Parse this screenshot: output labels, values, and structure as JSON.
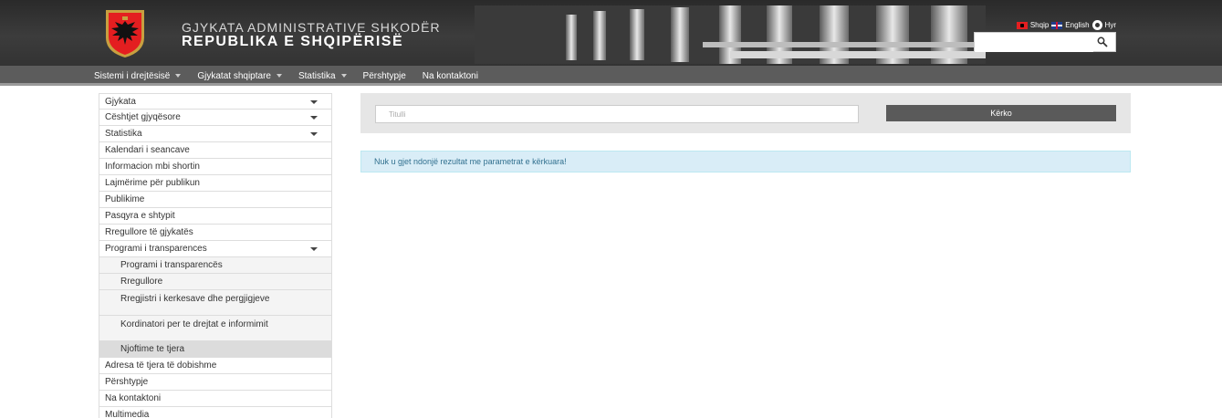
{
  "header": {
    "title": "GJYKATA ADMINISTRATIVE SHKODËR",
    "subtitle": "REPUBLIKA E SHQIPËRISË",
    "languages": [
      {
        "label": "Shqip",
        "icon": "albania-flag-icon"
      },
      {
        "label": "English",
        "icon": "uk-flag-icon"
      }
    ],
    "login_label": "Hyr",
    "search_placeholder": ""
  },
  "nav": {
    "items": [
      {
        "label": "Sistemi i drejtësisë",
        "dropdown": true
      },
      {
        "label": "Gjykatat shqiptare",
        "dropdown": true
      },
      {
        "label": "Statistika",
        "dropdown": true
      },
      {
        "label": "Përshtypje",
        "dropdown": false
      },
      {
        "label": "Na kontaktoni",
        "dropdown": false
      }
    ]
  },
  "sidebar": {
    "items": [
      {
        "label": "Gjykata",
        "dropdown": true
      },
      {
        "label": "Cështjet gjyqësore",
        "dropdown": true
      },
      {
        "label": "Statistika",
        "dropdown": true
      },
      {
        "label": "Kalendari i seancave"
      },
      {
        "label": "Informacion mbi shortin"
      },
      {
        "label": "Lajmërime për publikun"
      },
      {
        "label": "Publikime"
      },
      {
        "label": "Pasqyra e shtypit"
      },
      {
        "label": "Rregullore të gjykatës"
      },
      {
        "label": "Programi i transparences",
        "dropdown": true
      },
      {
        "label": "Programi i transparencës",
        "sub": true
      },
      {
        "label": "Rregullore",
        "sub": true
      },
      {
        "label": "Rregjistri i kerkesave dhe pergjigjeve",
        "sub": true,
        "two_line": true
      },
      {
        "label": "Kordinatori per te drejtat e informimit",
        "sub": true,
        "two_line": true
      },
      {
        "label": "Njoftime te tjera",
        "sub": true,
        "active": true
      },
      {
        "label": "Adresa të tjera të dobishme"
      },
      {
        "label": "Përshtypje"
      },
      {
        "label": "Na kontaktoni"
      },
      {
        "label": "Multimedia"
      }
    ]
  },
  "search": {
    "title_placeholder": "Titulli",
    "button_label": "Kërko"
  },
  "alert": {
    "message": "Nuk u gjet ndonjë rezultat me parametrat e kërkuara!"
  },
  "colors": {
    "header_bg": "#333333",
    "nav_bg": "#5c5c5c",
    "button_bg": "#5a5a5a",
    "alert_bg": "#d9edf7",
    "alert_text": "#31708f",
    "flag_red": "#e41e20"
  }
}
